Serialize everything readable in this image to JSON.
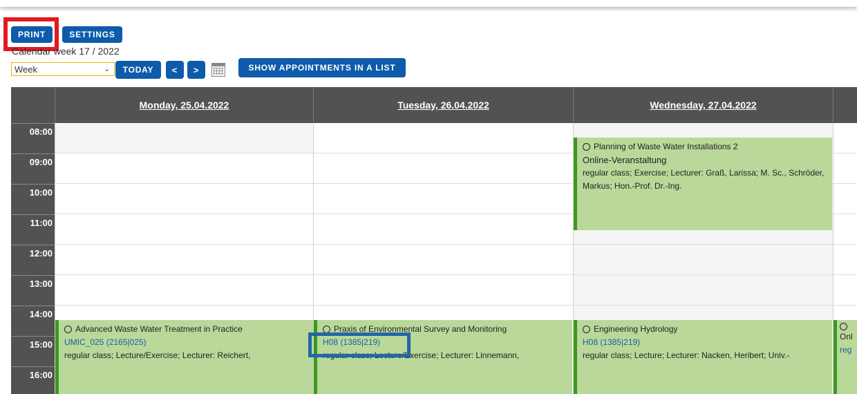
{
  "toolbar": {
    "print_label": "PRINT",
    "settings_label": "SETTINGS",
    "week_label": "Calendar week 17 / 2022",
    "view_value": "Week",
    "today_label": "TODAY",
    "prev_label": "<",
    "next_label": ">",
    "list_label": "SHOW APPOINTMENTS IN A LIST"
  },
  "calendar": {
    "days": [
      "Monday, 25.04.2022",
      "Tuesday, 26.04.2022",
      "Wednesday, 27.04.2022"
    ],
    "times": [
      "08:00",
      "09:00",
      "10:00",
      "11:00",
      "12:00",
      "13:00",
      "14:00",
      "15:00",
      "16:00"
    ],
    "events": {
      "wed_planning": {
        "title": "Planning of Waste Water Installations 2",
        "room": "Online-Veranstaltung",
        "desc": "regular class; Exercise; Lecturer: Graß, Larissa; M. Sc., Schröder, Markus; Hon.-Prof. Dr.-Ing."
      },
      "mon_advanced": {
        "title": "Advanced Waste Water Treatment in Practice",
        "room": "UMIC_025 (2165|025)",
        "desc": "regular class; Lecture/Exercise; Lecturer: Reichert,"
      },
      "tue_praxis": {
        "title": "Praxis of Environmental Survey and Monitoring",
        "room": "H08 (1385|219)",
        "desc": "regular class; Lecture/Exercise; Lecturer: Linnemann,"
      },
      "wed_hydrology": {
        "title": "Engineering Hydrology",
        "room": "H08 (1385|219)",
        "desc": "regular class; Lecture; Lecturer: Nacken, Heribert; Univ.-"
      },
      "thu_partial": {
        "title": "",
        "room": "Onl",
        "desc": "reg"
      }
    }
  },
  "colors": {
    "button_blue": "#0e5bab",
    "header_gray": "#525252",
    "event_green": "#b9d89a",
    "event_border": "#3a9a1c",
    "highlight_red": "#e3191f",
    "highlight_blue": "#2466a8"
  }
}
